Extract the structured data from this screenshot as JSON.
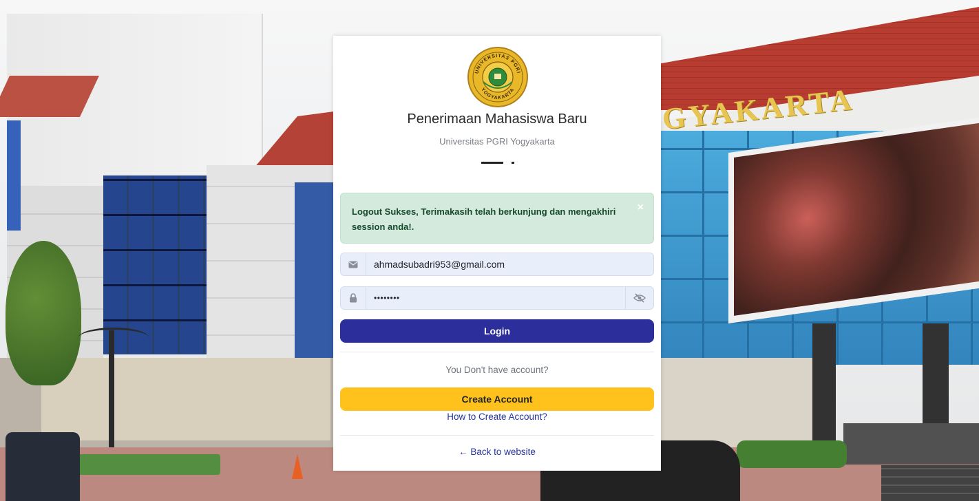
{
  "header": {
    "title": "Penerimaan Mahasiswa Baru",
    "subtitle": "Universitas PGRI Yogyakarta",
    "logo_text_top": "UNIVERSITAS PGRI",
    "logo_text_bottom": "YOGYAKARTA"
  },
  "background": {
    "sign_text": "GYAKARTA"
  },
  "alert": {
    "message": "Logout Sukses, Terimakasih telah berkunjung dan mengakhiri session anda!.",
    "close_label": "×"
  },
  "form": {
    "email_value": "ahmadsubadri953@gmail.com",
    "email_icon": "envelope-icon",
    "password_value": "••••••••",
    "password_icon": "lock-icon",
    "toggle_icon": "eye-slash-icon",
    "login_label": "Login"
  },
  "footer": {
    "no_account_text": "You Don't have account?",
    "create_account_label": "Create Account",
    "how_to_label": "How to Create Account?",
    "back_label": "← Back to website"
  },
  "colors": {
    "login_button": "#2c2e9c",
    "create_button": "#ffc21c",
    "alert_bg": "#d3eadd",
    "link": "#2633a0"
  }
}
